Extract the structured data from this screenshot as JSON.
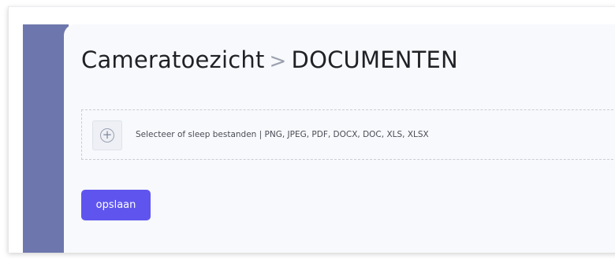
{
  "header": {
    "breadcrumb_parent": "Cameratoezicht",
    "breadcrumb_separator": ">",
    "breadcrumb_current": "DOCUMENTEN"
  },
  "upload": {
    "icon": "plus-circle-icon",
    "text": "Selecteer of sleep bestanden | PNG, JPEG, PDF, DOCX, DOC, XLS, XLSX"
  },
  "actions": {
    "save_label": "opslaan"
  },
  "colors": {
    "sidebar": "#6e77ad",
    "primary_button": "#5f55ee",
    "panel_background": "#f8f9fc"
  }
}
